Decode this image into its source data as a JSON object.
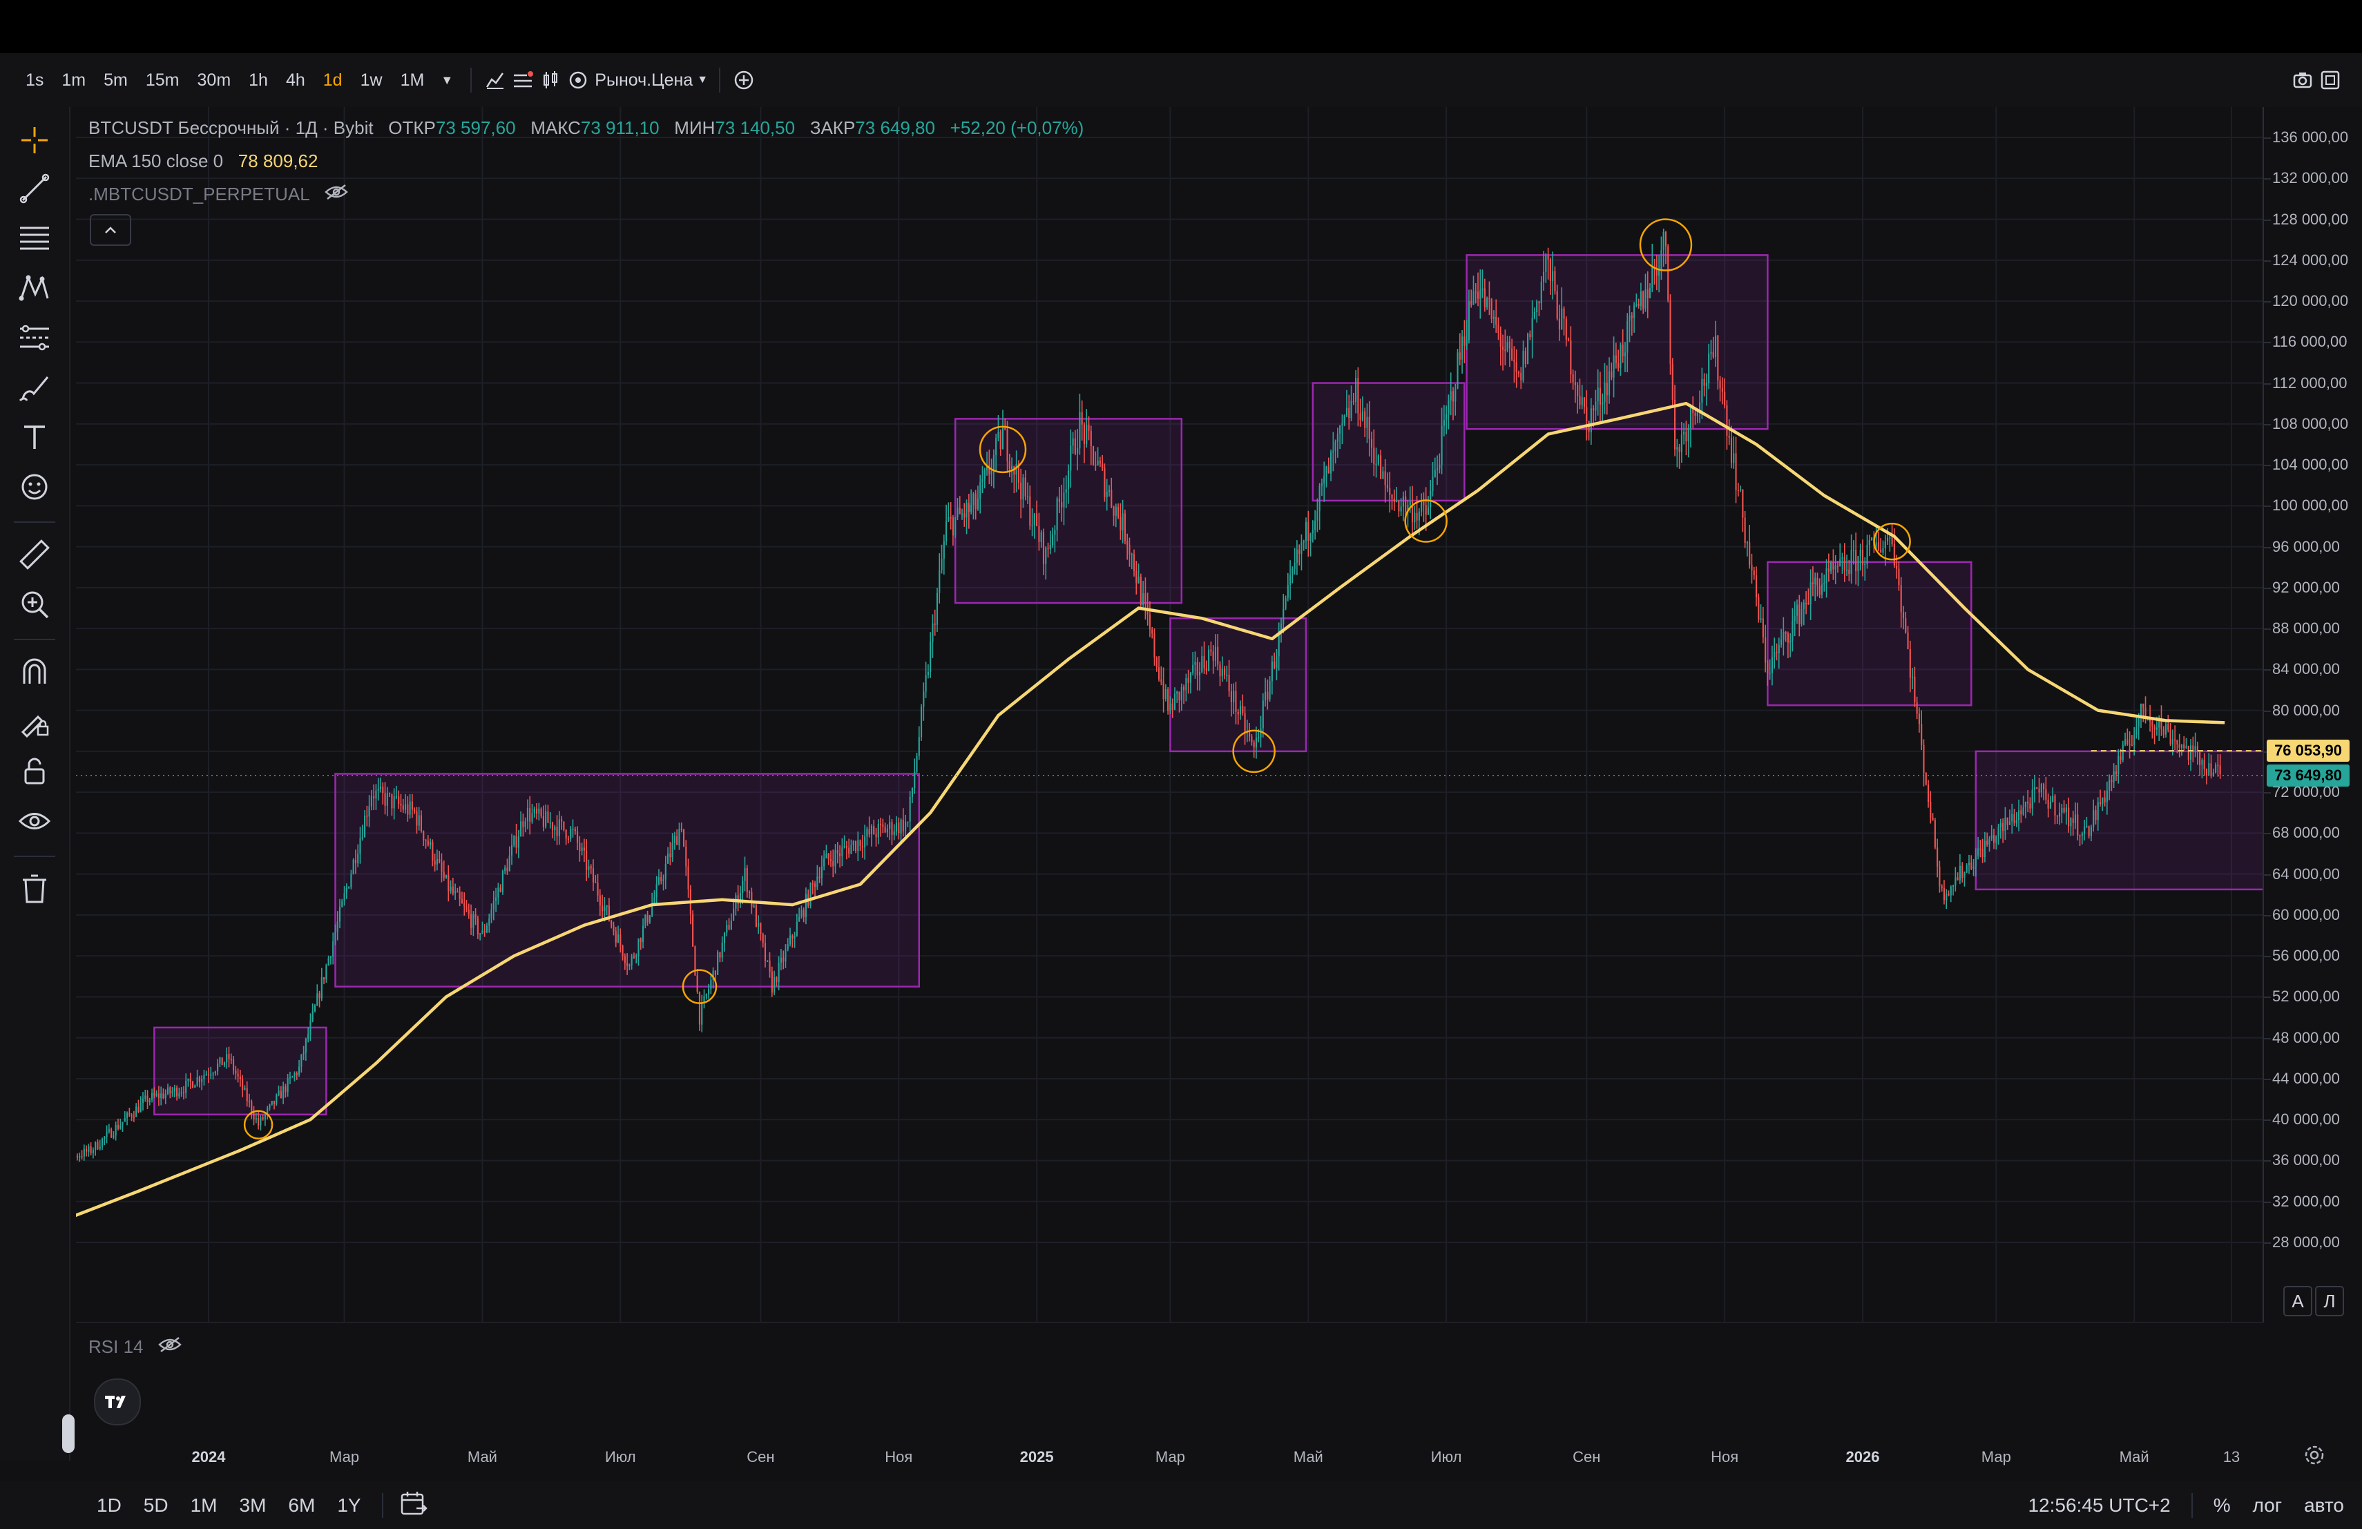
{
  "toolbar": {
    "intervals": [
      "1s",
      "1m",
      "5m",
      "15m",
      "30m",
      "1h",
      "4h",
      "1d",
      "1w",
      "1M"
    ],
    "active_interval": "1d",
    "price_type": "Рыноч.Цена"
  },
  "legend": {
    "symbol": "BTCUSDT Бессрочный · 1Д · Bybit",
    "open_label": "ОТКР",
    "open": "73 597,60",
    "high_label": "МАКС",
    "high": "73 911,10",
    "low_label": "МИН",
    "low": "73 140,50",
    "close_label": "ЗАКР",
    "close": "73 649,80",
    "change": "+52,20 (+0,07%)",
    "ema_label": "EMA 150 close 0",
    "ema_value": "78 809,62",
    "index_label": ".MBTCUSDT_PERPETUAL"
  },
  "rsi_label": "RSI 14",
  "price_tags": {
    "mark": "76 053,90",
    "last": "73 649,80"
  },
  "colors": {
    "up": "#26a69a",
    "down": "#ef5350",
    "ema": "#f7d774",
    "box": "#9c27b0",
    "accent": "#f7a600"
  },
  "scale_buttons": [
    "A",
    "Л"
  ],
  "bottombar": {
    "ranges": [
      "1D",
      "5D",
      "1M",
      "3M",
      "6M",
      "1Y"
    ],
    "time": "12:56:45 UTC+2",
    "percent": "%",
    "log": "лог",
    "auto": "авто"
  },
  "chart_data": {
    "type": "candlestick",
    "symbol": "BTCUSDT",
    "y_ticks": [
      28000,
      32000,
      36000,
      40000,
      44000,
      48000,
      52000,
      56000,
      60000,
      64000,
      68000,
      72000,
      76000,
      80000,
      84000,
      88000,
      92000,
      96000,
      100000,
      104000,
      108000,
      112000,
      116000,
      120000,
      124000,
      128000,
      132000,
      136000
    ],
    "y_tick_labels": [
      "28 000,00",
      "32 000,00",
      "36 000,00",
      "40 000,00",
      "44 000,00",
      "48 000,00",
      "52 000,00",
      "56 000,00",
      "60 000,00",
      "64 000,00",
      "68 000,00",
      "72 000,00",
      "76 000,00",
      "80 000,00",
      "84 000,00",
      "88 000,00",
      "92 000,00",
      "96 000,00",
      "100 000,00",
      "104 000,00",
      "108 000,00",
      "112 000,00",
      "116 000,00",
      "120 000,00",
      "124 000,00",
      "128 000,00",
      "132 000,00",
      "136 000,00"
    ],
    "ylim": [
      24000,
      138000
    ],
    "x_range": [
      "2023-10-15",
      "2026-06-20"
    ],
    "x_ticks": [
      {
        "label": "2024",
        "date": "2024-01-01",
        "bold": true
      },
      {
        "label": "Мар",
        "date": "2024-03-01"
      },
      {
        "label": "Май",
        "date": "2024-05-01"
      },
      {
        "label": "Июл",
        "date": "2024-07-01"
      },
      {
        "label": "Сен",
        "date": "2024-09-01"
      },
      {
        "label": "Ноя",
        "date": "2024-11-01"
      },
      {
        "label": "2025",
        "date": "2025-01-01",
        "bold": true
      },
      {
        "label": "Мар",
        "date": "2025-03-01"
      },
      {
        "label": "Май",
        "date": "2025-05-01"
      },
      {
        "label": "Июл",
        "date": "2025-07-01"
      },
      {
        "label": "Сен",
        "date": "2025-09-01"
      },
      {
        "label": "Ноя",
        "date": "2025-11-01"
      },
      {
        "label": "2026",
        "date": "2026-01-01",
        "bold": true
      },
      {
        "label": "Мар",
        "date": "2026-03-01"
      },
      {
        "label": "Май",
        "date": "2026-05-01"
      },
      {
        "label": "13",
        "date": "2026-06-13"
      }
    ],
    "price_path": [
      [
        "2023-10-16",
        35000
      ],
      [
        "2023-11-10",
        37000
      ],
      [
        "2023-12-05",
        42000
      ],
      [
        "2023-12-20",
        43000
      ],
      [
        "2024-01-10",
        46000
      ],
      [
        "2024-01-23",
        39500
      ],
      [
        "2024-02-10",
        45000
      ],
      [
        "2024-02-28",
        60000
      ],
      [
        "2024-03-13",
        72000
      ],
      [
        "2024-04-01",
        70000
      ],
      [
        "2024-04-15",
        63000
      ],
      [
        "2024-05-01",
        58000
      ],
      [
        "2024-05-20",
        70000
      ],
      [
        "2024-06-10",
        68000
      ],
      [
        "2024-07-05",
        55000
      ],
      [
        "2024-07-28",
        69000
      ],
      [
        "2024-08-05",
        50000
      ],
      [
        "2024-08-25",
        64000
      ],
      [
        "2024-09-06",
        53000
      ],
      [
        "2024-09-28",
        65000
      ],
      [
        "2024-10-20",
        68000
      ],
      [
        "2024-11-05",
        69000
      ],
      [
        "2024-11-22",
        98000
      ],
      [
        "2024-12-05",
        100000
      ],
      [
        "2024-12-17",
        107000
      ],
      [
        "2025-01-05",
        95000
      ],
      [
        "2025-01-20",
        108000
      ],
      [
        "2025-02-10",
        97000
      ],
      [
        "2025-02-28",
        80000
      ],
      [
        "2025-03-20",
        86000
      ],
      [
        "2025-04-07",
        76000
      ],
      [
        "2025-04-25",
        94000
      ],
      [
        "2025-05-22",
        111000
      ],
      [
        "2025-06-05",
        101000
      ],
      [
        "2025-06-22",
        99000
      ],
      [
        "2025-07-14",
        122000
      ],
      [
        "2025-08-02",
        112000
      ],
      [
        "2025-08-14",
        124000
      ],
      [
        "2025-09-01",
        108000
      ],
      [
        "2025-09-20",
        117000
      ],
      [
        "2025-10-06",
        126000
      ],
      [
        "2025-10-10",
        105000
      ],
      [
        "2025-10-28",
        115000
      ],
      [
        "2025-11-20",
        84000
      ],
      [
        "2025-12-10",
        92000
      ],
      [
        "2026-01-14",
        97000
      ],
      [
        "2026-02-05",
        62000
      ],
      [
        "2026-02-25",
        67000
      ],
      [
        "2026-03-20",
        72000
      ],
      [
        "2026-04-10",
        68000
      ],
      [
        "2026-05-05",
        80000
      ],
      [
        "2026-05-25",
        76000
      ],
      [
        "2026-06-08",
        73650
      ]
    ],
    "ema": {
      "name": "EMA 150 close 0",
      "points": [
        [
          "2023-10-15",
          29000
        ],
        [
          "2023-12-01",
          33000
        ],
        [
          "2024-01-15",
          37000
        ],
        [
          "2024-02-15",
          40000
        ],
        [
          "2024-03-15",
          45500
        ],
        [
          "2024-04-15",
          52000
        ],
        [
          "2024-05-15",
          56000
        ],
        [
          "2024-06-15",
          59000
        ],
        [
          "2024-07-15",
          61000
        ],
        [
          "2024-08-15",
          61500
        ],
        [
          "2024-09-15",
          61000
        ],
        [
          "2024-10-15",
          63000
        ],
        [
          "2024-11-15",
          70000
        ],
        [
          "2024-12-15",
          79500
        ],
        [
          "2025-01-15",
          85000
        ],
        [
          "2025-02-15",
          90000
        ],
        [
          "2025-03-15",
          89000
        ],
        [
          "2025-04-15",
          87000
        ],
        [
          "2025-05-15",
          92000
        ],
        [
          "2025-06-15",
          97000
        ],
        [
          "2025-07-15",
          101500
        ],
        [
          "2025-08-15",
          107000
        ],
        [
          "2025-09-15",
          108500
        ],
        [
          "2025-10-15",
          110000
        ],
        [
          "2025-11-15",
          106000
        ],
        [
          "2025-12-15",
          101000
        ],
        [
          "2026-01-15",
          97000
        ],
        [
          "2026-02-15",
          90000
        ],
        [
          "2026-03-15",
          84000
        ],
        [
          "2026-04-15",
          80000
        ],
        [
          "2026-05-15",
          79000
        ],
        [
          "2026-06-10",
          78800
        ]
      ]
    },
    "boxes": [
      {
        "from": "2023-12-08",
        "to": "2024-02-22",
        "top": 49000,
        "bottom": 40500
      },
      {
        "from": "2024-02-26",
        "to": "2024-11-10",
        "top": 73800,
        "bottom": 53000
      },
      {
        "from": "2024-11-26",
        "to": "2025-03-06",
        "top": 108500,
        "bottom": 90500
      },
      {
        "from": "2025-03-01",
        "to": "2025-04-30",
        "top": 89000,
        "bottom": 76000
      },
      {
        "from": "2025-05-03",
        "to": "2025-07-09",
        "top": 112000,
        "bottom": 100500
      },
      {
        "from": "2025-07-10",
        "to": "2025-11-20",
        "top": 124500,
        "bottom": 107500
      },
      {
        "from": "2025-11-20",
        "to": "2026-02-18",
        "top": 94500,
        "bottom": 80500
      },
      {
        "from": "2026-02-20",
        "to": "2026-07-01",
        "top": 76000,
        "bottom": 62500
      }
    ],
    "circles": [
      {
        "date": "2024-01-23",
        "price": 39500,
        "r": 20
      },
      {
        "date": "2024-08-05",
        "price": 53000,
        "r": 24
      },
      {
        "date": "2024-12-17",
        "price": 105500,
        "r": 33
      },
      {
        "date": "2025-04-07",
        "price": 76000,
        "r": 30
      },
      {
        "date": "2025-06-22",
        "price": 98500,
        "r": 30
      },
      {
        "date": "2025-10-06",
        "price": 125500,
        "r": 37
      },
      {
        "date": "2026-01-14",
        "price": 96500,
        "r": 26
      }
    ],
    "mark_price": 76053.9,
    "last_price": 73649.8
  }
}
